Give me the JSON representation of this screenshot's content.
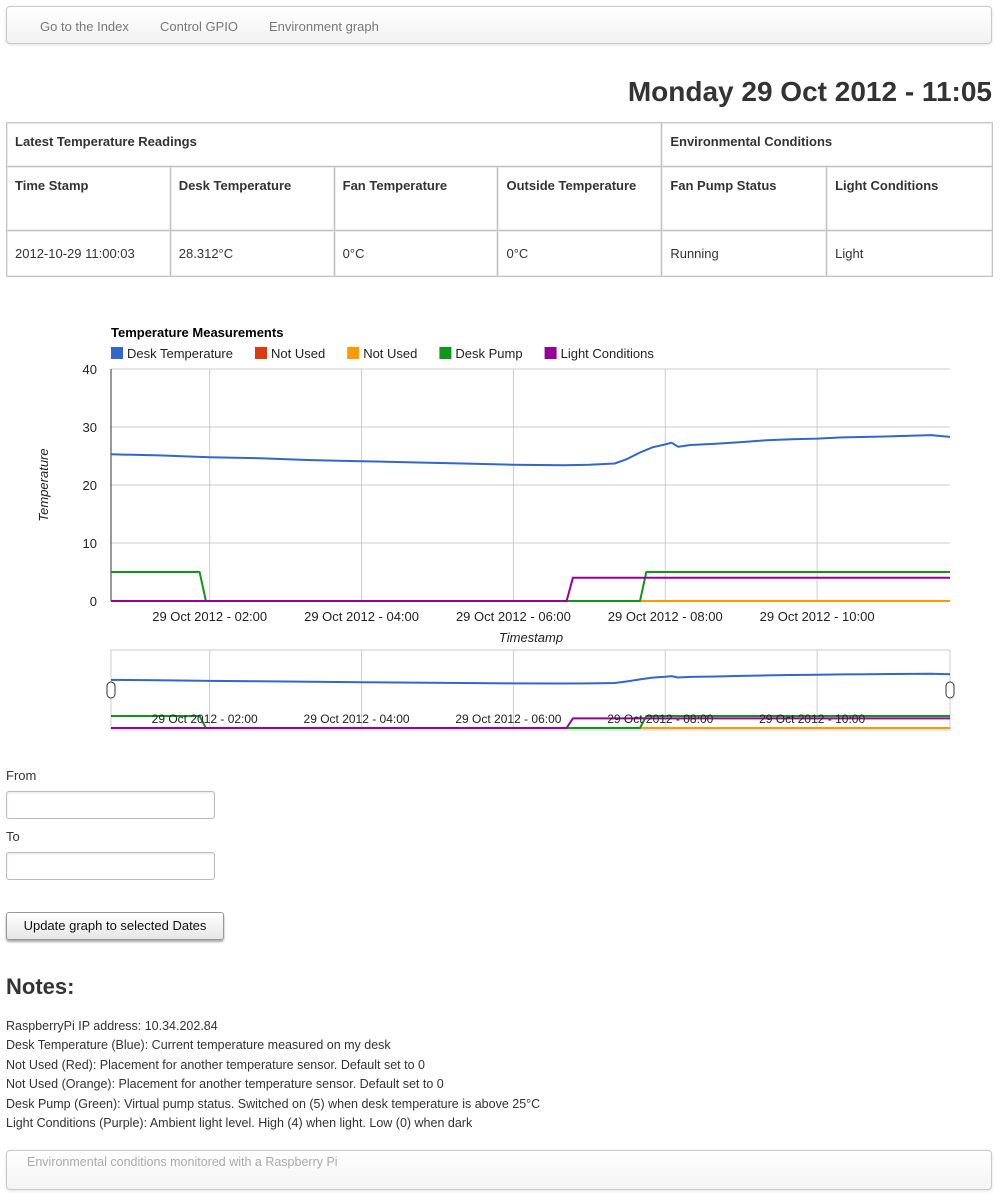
{
  "nav": {
    "items": [
      "Go to the Index",
      "Control GPIO",
      "Environment graph"
    ]
  },
  "page_time": "Monday 29 Oct 2012 - 11:05",
  "table": {
    "section_latest": "Latest Temperature Readings",
    "section_env": "Environmental Conditions",
    "headers": [
      "Time Stamp",
      "Desk Temperature",
      "Fan Temperature",
      "Outside Temperature",
      "Fan Pump Status",
      "Light Conditions"
    ],
    "row": [
      "2012-10-29 11:00:03",
      "28.312°C",
      "0°C",
      "0°C",
      "Running",
      "Light"
    ]
  },
  "chart_data": {
    "type": "line",
    "title": "Temperature Measurements",
    "xlabel": "Timestamp",
    "ylabel": "Temperature",
    "ylim": [
      0,
      40
    ],
    "yticks": [
      0,
      10,
      20,
      30,
      40
    ],
    "xlim": [
      "29 Oct 2012 - 00:42",
      "29 Oct 2012 - 11:45"
    ],
    "xticks": [
      "29 Oct 2012 - 02:00",
      "29 Oct 2012 - 04:00",
      "29 Oct 2012 - 06:00",
      "29 Oct 2012 - 08:00",
      "29 Oct 2012 - 10:00"
    ],
    "grid": true,
    "legend_position": "top-left",
    "navigator_ticks": [
      "29 Oct 2012 - 02:00",
      "29 Oct 2012 - 04:00",
      "29 Oct 2012 - 06:00",
      "29 Oct 2012 - 08:00",
      "29 Oct 2012 - 10:00"
    ],
    "series": [
      {
        "name": "Desk Temperature",
        "color": "#3366cc",
        "points": [
          [
            "00:42",
            25.3
          ],
          [
            "01:20",
            25.1
          ],
          [
            "02:00",
            24.8
          ],
          [
            "02:40",
            24.6
          ],
          [
            "03:20",
            24.3
          ],
          [
            "04:00",
            24.1
          ],
          [
            "04:40",
            23.9
          ],
          [
            "05:20",
            23.7
          ],
          [
            "06:00",
            23.5
          ],
          [
            "06:40",
            23.4
          ],
          [
            "07:00",
            23.5
          ],
          [
            "07:20",
            23.7
          ],
          [
            "07:30",
            24.5
          ],
          [
            "07:40",
            25.6
          ],
          [
            "07:50",
            26.5
          ],
          [
            "08:00",
            27.0
          ],
          [
            "08:05",
            27.3
          ],
          [
            "08:10",
            26.6
          ],
          [
            "08:20",
            26.9
          ],
          [
            "08:40",
            27.1
          ],
          [
            "09:00",
            27.4
          ],
          [
            "09:20",
            27.7
          ],
          [
            "09:40",
            27.9
          ],
          [
            "10:00",
            28.0
          ],
          [
            "10:20",
            28.2
          ],
          [
            "10:40",
            28.3
          ],
          [
            "11:00",
            28.4
          ],
          [
            "11:30",
            28.6
          ],
          [
            "11:45",
            28.3
          ]
        ]
      },
      {
        "name": "Not Used",
        "color": "#dc3912",
        "points": [
          [
            "00:42",
            0
          ],
          [
            "11:45",
            0
          ]
        ]
      },
      {
        "name": "Not Used",
        "color": "#ff9900",
        "points": [
          [
            "00:42",
            0
          ],
          [
            "11:45",
            0
          ]
        ]
      },
      {
        "name": "Desk Pump",
        "color": "#109618",
        "points": [
          [
            "00:42",
            5
          ],
          [
            "01:52",
            5
          ],
          [
            "01:57",
            0
          ],
          [
            "07:40",
            0
          ],
          [
            "07:45",
            5
          ],
          [
            "11:45",
            5
          ]
        ]
      },
      {
        "name": "Light Conditions",
        "color": "#990099",
        "points": [
          [
            "00:42",
            0
          ],
          [
            "06:42",
            0
          ],
          [
            "06:47",
            4
          ],
          [
            "11:45",
            4
          ]
        ]
      }
    ]
  },
  "form": {
    "from_label": "From",
    "to_label": "To",
    "from_value": "",
    "to_value": "",
    "button_label": "Update graph to selected Dates"
  },
  "notes": {
    "title": "Notes:",
    "lines": [
      "RaspberryPi IP address: 10.34.202.84",
      "Desk Temperature (Blue): Current temperature measured on my desk",
      "Not Used (Red): Placement for another temperature sensor. Default set to 0",
      "Not Used (Orange): Placement for another temperature sensor. Default set to 0",
      "Desk Pump (Green): Virtual pump status. Switched on (5) when desk temperature is above 25°C",
      "Light Conditions (Purple): Ambient light level. High (4) when light. Low (0) when dark"
    ]
  },
  "footer": {
    "text": "Environmental conditions monitored with a Raspberry Pi"
  }
}
